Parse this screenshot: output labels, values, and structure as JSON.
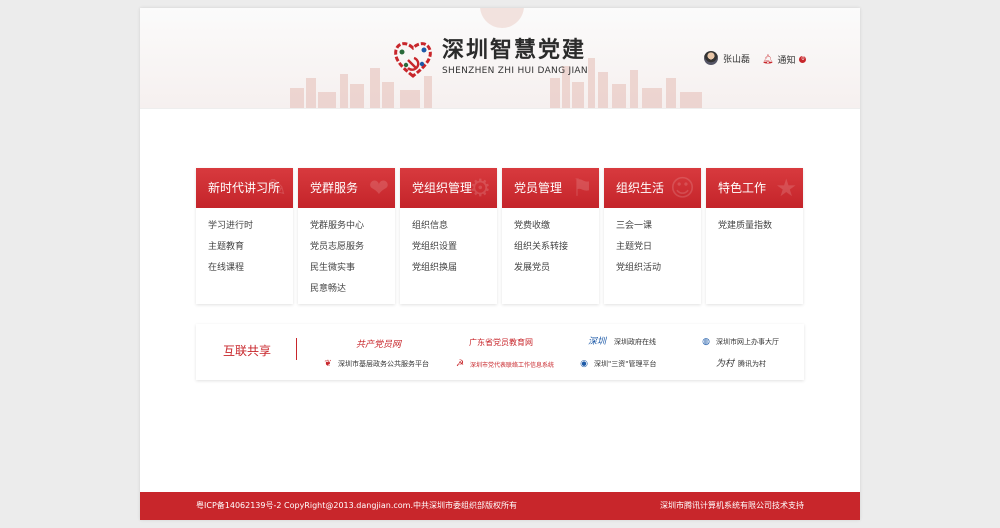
{
  "header": {
    "brand_cn": "深圳智慧党建",
    "brand_en": "SHENZHEN ZHI HUI DANG JIAN",
    "user_name": "张山磊",
    "notify_label": "通知",
    "notify_count": "0"
  },
  "columns": [
    {
      "title": "新时代讲习所",
      "items": [
        "学习进行时",
        "主题教育",
        "在线课程"
      ]
    },
    {
      "title": "党群服务",
      "items": [
        "党群服务中心",
        "党员志愿服务",
        "民生微实事",
        "民意畅达"
      ]
    },
    {
      "title": "党组织管理",
      "items": [
        "组织信息",
        "党组织设置",
        "党组织换届"
      ]
    },
    {
      "title": "党员管理",
      "items": [
        "党费收缴",
        "组织关系转接",
        "发展党员"
      ]
    },
    {
      "title": "组织生活",
      "items": [
        "三会一课",
        "主题党日",
        "党组织活动"
      ]
    },
    {
      "title": "特色工作",
      "items": [
        "党建质量指数"
      ]
    }
  ],
  "share": {
    "title": "互联共享",
    "links": [
      {
        "label": "共产党员网"
      },
      {
        "label": "广东省党员教育网"
      },
      {
        "label": "深圳政府在线"
      },
      {
        "label": "深圳市网上办事大厅"
      },
      {
        "label": "深圳市基层政务公共服务平台"
      },
      {
        "label": "深圳市党代表联络工作信息系统"
      },
      {
        "label": "深圳\"三资\"管理平台"
      },
      {
        "label": "腾讯为村"
      }
    ]
  },
  "footer": {
    "left": "粤ICP备14062139号-2  CopyRight@2013.dangjian.com.中共深圳市委组织部版权所有",
    "right": "深圳市腾讯计算机系统有限公司技术支持"
  },
  "colors": {
    "brand_red": "#c8262b"
  }
}
